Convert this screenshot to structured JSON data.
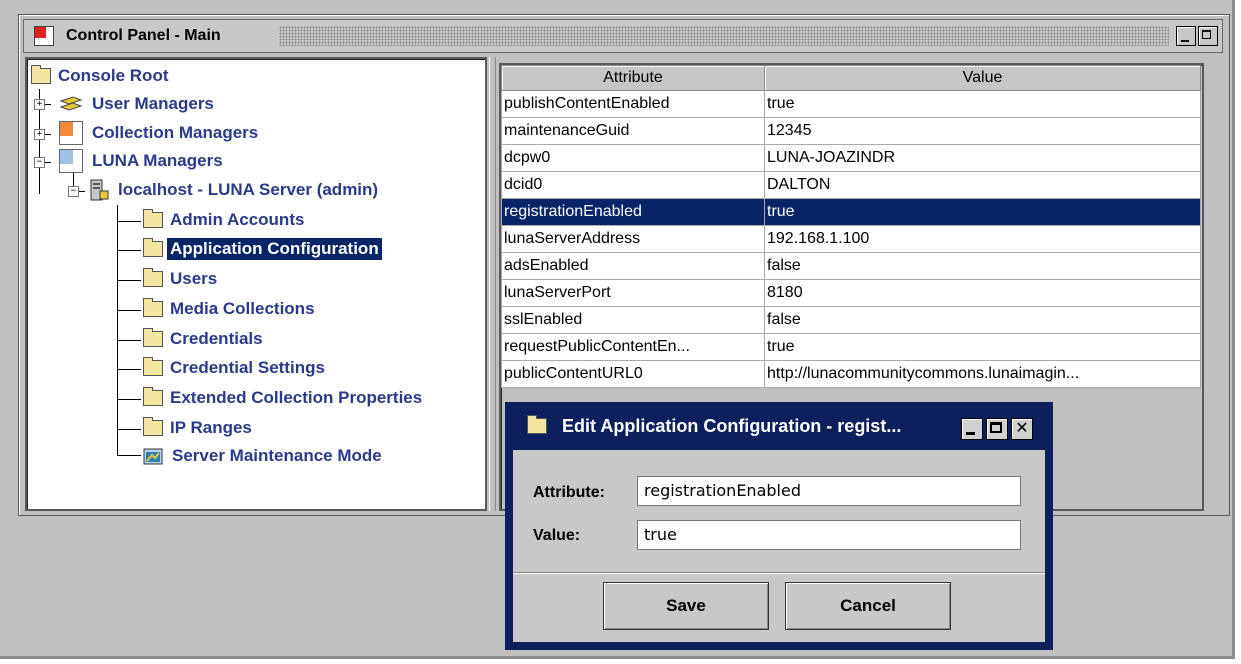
{
  "window": {
    "title": "Control Panel - Main"
  },
  "tree": {
    "root": "Console Root",
    "managers": [
      "User Managers",
      "Collection Managers",
      "LUNA Managers"
    ],
    "server": "localhost - LUNA Server (admin)",
    "children": [
      "Admin Accounts",
      "Application Configuration",
      "Users",
      "Media Collections",
      "Credentials",
      "Credential Settings",
      "Extended Collection Properties",
      "IP Ranges",
      "Server Maintenance Mode"
    ],
    "selected": "Application Configuration"
  },
  "table": {
    "headers": [
      "Attribute",
      "Value"
    ],
    "rows": [
      [
        "publishContentEnabled",
        "true"
      ],
      [
        "maintenanceGuid",
        "12345"
      ],
      [
        "dcpw0",
        "LUNA-JOAZINDR"
      ],
      [
        "dcid0",
        "DALTON"
      ],
      [
        "registrationEnabled",
        "true"
      ],
      [
        "lunaServerAddress",
        "192.168.1.100"
      ],
      [
        "adsEnabled",
        "false"
      ],
      [
        "lunaServerPort",
        "8180"
      ],
      [
        "sslEnabled",
        "false"
      ],
      [
        "requestPublicContentEn...",
        "true"
      ],
      [
        "publicContentURL0",
        "http://lunacommunitycommons.lunaimagin..."
      ]
    ],
    "selected_row": 4
  },
  "dialog": {
    "title": "Edit Application Configuration - regist...",
    "attribute_label": "Attribute:",
    "attribute_value": "registrationEnabled",
    "value_label": "Value:",
    "value_value": "true",
    "save_label": "Save",
    "cancel_label": "Cancel",
    "close_glyph": "✕"
  },
  "colors": {
    "selection": "#0a2468",
    "tree_text": "#2b3a8a",
    "dialog_frame": "#0d1f5c"
  }
}
